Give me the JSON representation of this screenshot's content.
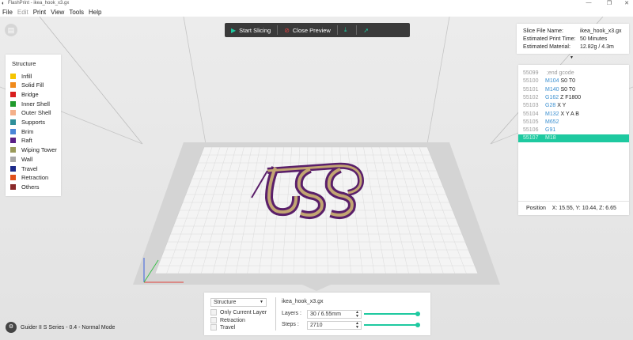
{
  "window": {
    "app_title": "FlashPrint - ikea_hook_x3.gx"
  },
  "menu": [
    {
      "label": "File",
      "enabled": true
    },
    {
      "label": "Edit",
      "enabled": false
    },
    {
      "label": "Print",
      "enabled": true
    },
    {
      "label": "View",
      "enabled": true
    },
    {
      "label": "Tools",
      "enabled": true
    },
    {
      "label": "Help",
      "enabled": true
    }
  ],
  "toolbar": {
    "start_slicing": "Start Slicing",
    "close_preview": "Close Preview"
  },
  "legend": {
    "heading": "Structure",
    "items": [
      {
        "label": "Infill",
        "color": "#f5c400"
      },
      {
        "label": "Solid Fill",
        "color": "#f08a1c"
      },
      {
        "label": "Bridge",
        "color": "#d81e1e"
      },
      {
        "label": "Inner Shell",
        "color": "#1f9a2c"
      },
      {
        "label": "Outer Shell",
        "color": "#f4b08a"
      },
      {
        "label": "Supports",
        "color": "#2f8f9a"
      },
      {
        "label": "Brim",
        "color": "#4a86d8"
      },
      {
        "label": "Raft",
        "color": "#5a1f86"
      },
      {
        "label": "Wiping Tower",
        "color": "#9a9a5a"
      },
      {
        "label": "Wall",
        "color": "#a8a8a8"
      },
      {
        "label": "Travel",
        "color": "#1c2a8a"
      },
      {
        "label": "Retraction",
        "color": "#e0501a"
      },
      {
        "label": "Others",
        "color": "#8a2a2a"
      }
    ]
  },
  "slice_info": {
    "file_name_label": "Slice File Name:",
    "file_name_value": "ikea_hook_x3.gx",
    "print_time_label": "Estimated Print Time:",
    "print_time_value": "50 Minutes",
    "material_label": "Estimated Material:",
    "material_value": "12.82g / 4.3m"
  },
  "gcode": {
    "lines": [
      {
        "num": "55099",
        "cmd": "",
        "args": "",
        "comment": ";end gcode"
      },
      {
        "num": "55100",
        "cmd": "M104",
        "args": "S0 T0",
        "comment": ""
      },
      {
        "num": "55101",
        "cmd": "M140",
        "args": "S0 T0",
        "comment": ""
      },
      {
        "num": "55102",
        "cmd": "G162",
        "args": "Z F1800",
        "comment": ""
      },
      {
        "num": "55103",
        "cmd": "G28",
        "args": "X Y",
        "comment": ""
      },
      {
        "num": "55104",
        "cmd": "M132",
        "args": "X Y A B",
        "comment": ""
      },
      {
        "num": "55105",
        "cmd": "M652",
        "args": "",
        "comment": ""
      },
      {
        "num": "55106",
        "cmd": "G91",
        "args": "",
        "comment": ""
      },
      {
        "num": "55107",
        "cmd": "M18",
        "args": "",
        "comment": ""
      }
    ],
    "position_label": "Position",
    "position_value": "X: 15.55, Y: 10.44, Z: 6.65"
  },
  "bottom": {
    "mode_select": "Structure",
    "only_current_layer": "Only Current Layer",
    "retraction": "Retraction",
    "travel": "Travel",
    "file_name": "ikea_hook_x3.gx",
    "layers_label": "Layers :",
    "layers_value": "30 / 6.55mm",
    "steps_label": "Steps :",
    "steps_value": "2710",
    "layers_progress": 1.0,
    "steps_progress": 1.0
  },
  "status": {
    "printer": "Guider II S Series - 0.4 - Normal Mode"
  },
  "colors": {
    "accent": "#1ec9a0",
    "toolbar_bg": "#3a3a3a"
  }
}
